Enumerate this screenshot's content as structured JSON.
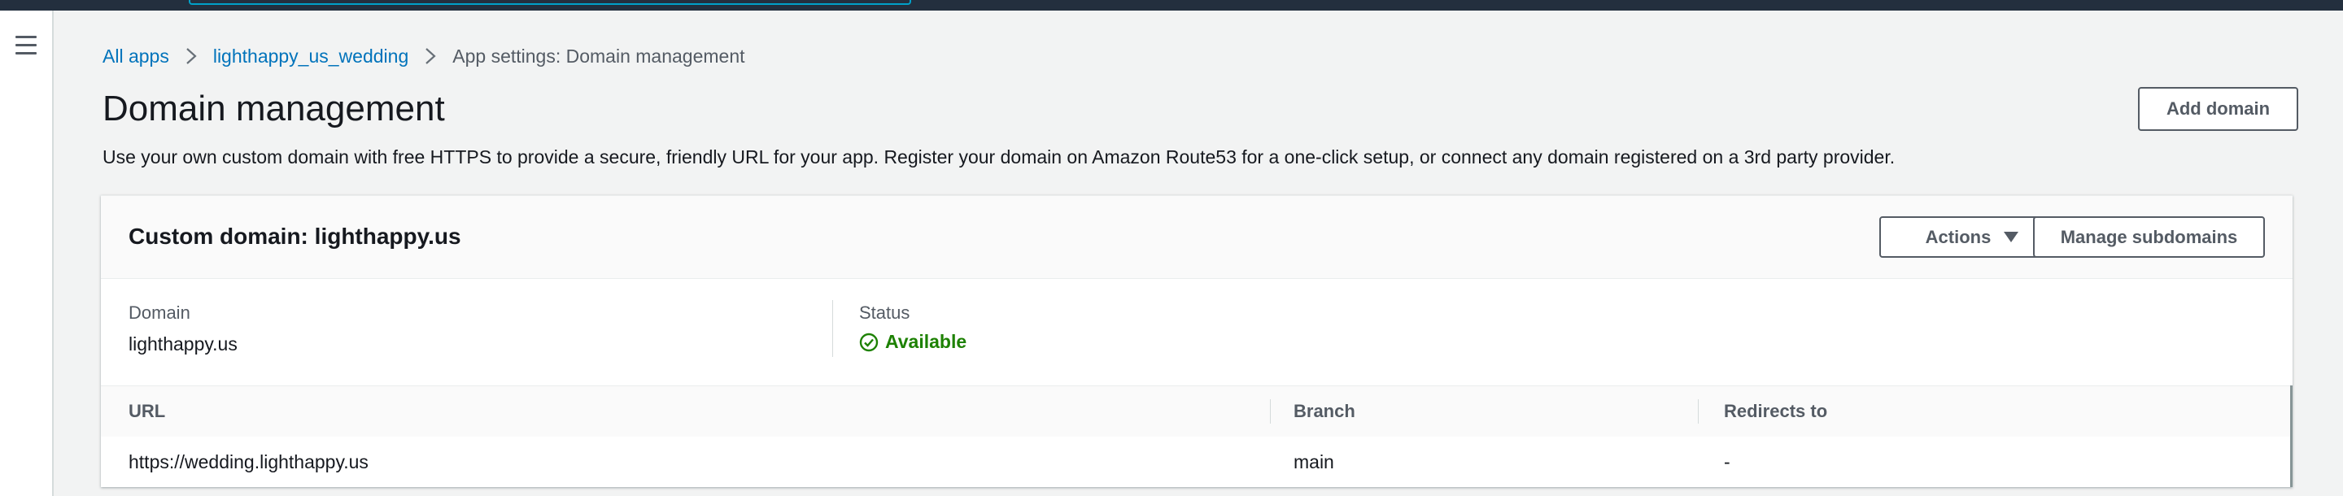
{
  "breadcrumb": {
    "all_apps": "All apps",
    "app_name": "lighthappy_us_wedding",
    "current": "App settings: Domain management"
  },
  "page": {
    "title": "Domain management",
    "description": "Use your own custom domain with free HTTPS to provide a secure, friendly URL for your app. Register your domain on Amazon Route53 for a one-click setup, or connect any domain registered on a 3rd party provider.",
    "add_domain_label": "Add domain"
  },
  "panel": {
    "title": "Custom domain: lighthappy.us",
    "actions_label": "Actions",
    "manage_subdomains_label": "Manage subdomains",
    "domain_label": "Domain",
    "domain_value": "lighthappy.us",
    "status_label": "Status",
    "status_value": "Available"
  },
  "table": {
    "headers": {
      "url": "URL",
      "branch": "Branch",
      "redirects": "Redirects to"
    },
    "rows": [
      {
        "url": "https://wedding.lighthappy.us",
        "branch": "main",
        "redirects": "-"
      }
    ]
  },
  "colors": {
    "header_bg": "#232f3e",
    "link": "#0073bb",
    "success": "#1d8102",
    "page_bg": "#f2f3f3"
  },
  "icons": {
    "menu": "hamburger-menu-icon",
    "breadcrumb_separator": "chevron-right-icon",
    "actions_caret": "caret-down-icon",
    "status": "check-circle-icon"
  }
}
